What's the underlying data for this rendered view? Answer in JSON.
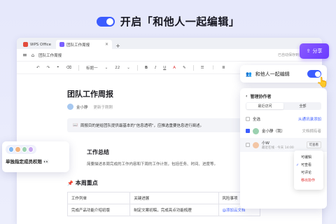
{
  "headline": {
    "text": "开启「和他人一起编辑」"
  },
  "tabs": [
    {
      "label": "WPS Office"
    },
    {
      "label": "团队工作周报"
    }
  ],
  "docbar": {
    "title": "团队工作周报",
    "status": "已自动保存到云端"
  },
  "toolbar": {
    "style": "标题一",
    "size": "22",
    "bold": "B",
    "italic": "I",
    "underline": "U",
    "font_color": "A"
  },
  "document": {
    "title": "团队工作周报",
    "author": "金小静",
    "updated": "更新于刚刚",
    "notice": "周报目的是给团队提供最基本的“信息透明”，应推选重要信息进行阐述。",
    "section1_title": "工作总结",
    "section1_desc": "简要描述本周完成的工作内容和下周的工作计划，包括任务、时间、进度等。",
    "section2_title": "本周重点",
    "table": {
      "headers": [
        "工作列单",
        "关键进展",
        "风险事项"
      ],
      "rows": [
        [
          "完成产品功能介绍初版",
          "制定文案初稿，完成亮点功能梳理",
          "@添加云文档"
        ]
      ]
    }
  },
  "share_button": {
    "label": "分享"
  },
  "collab_card": {
    "label": "和他人一起编辑"
  },
  "panel": {
    "title": "管理协作者",
    "tabs": [
      "最近访问",
      "全部"
    ],
    "select_all": "全选",
    "add_contacts": "从通讯录添加",
    "users": [
      {
        "name": "金小静（我）",
        "role": "文档拥有者"
      },
      {
        "name": "小W",
        "sub": "最近在线 · 今天 14:00",
        "perm": "可查看"
      }
    ]
  },
  "dropdown": {
    "items": [
      "可编辑",
      "可查看",
      "可评论",
      "移出协作"
    ],
    "selected": "可查看"
  },
  "perm_card": {
    "label": "单独指定成员权限"
  },
  "colors": {
    "accent": "#3b5cff",
    "share": "#7b4bff",
    "danger": "#e03030"
  }
}
